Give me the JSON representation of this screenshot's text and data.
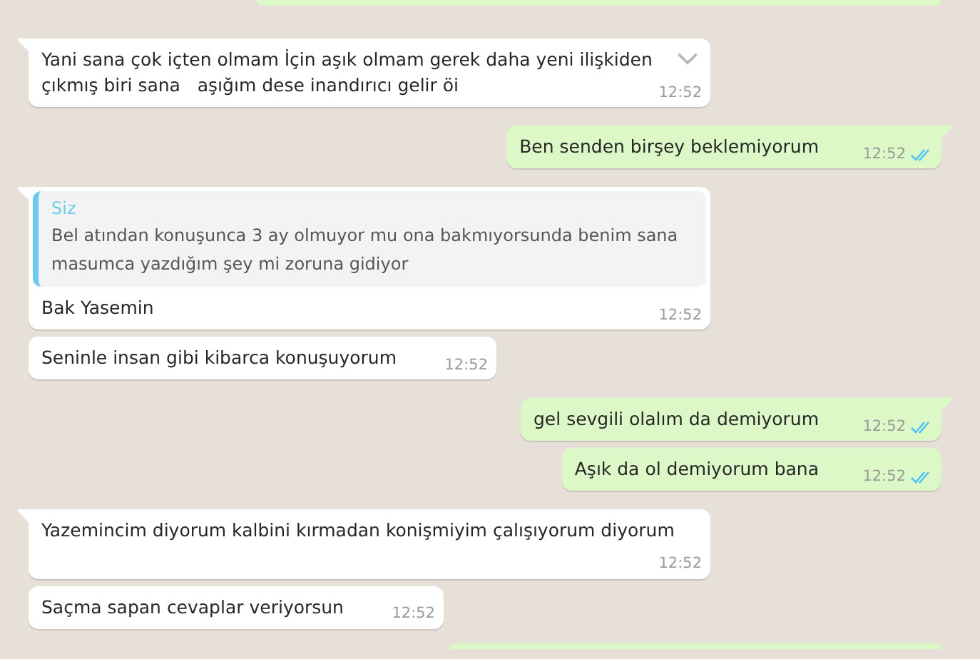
{
  "messages": [
    {
      "kind": "edge-out"
    },
    {
      "kind": "in",
      "tail": true,
      "menu": true,
      "text": "Yani sana çok içten olmam İçin aşık olmam gerek daha yeni ilişkiden çıkmış biri sana   aşığım dese inandırıcı gelir öi",
      "time": "12:52"
    },
    {
      "kind": "out",
      "tail": true,
      "read": true,
      "text": "Ben senden birşey beklemiyorum",
      "time": "12:52"
    },
    {
      "kind": "in",
      "tail": true,
      "quote": {
        "author": "Siz",
        "text": "Bel atından konuşunca 3 ay olmuyor mu ona bakmıyorsunda benim sana masumca yazdığım şey mi zoruna gidiyor"
      },
      "text": "Bak Yasemin",
      "time": "12:52"
    },
    {
      "kind": "in",
      "tail": false,
      "text": "Seninle insan gibi kibarca konuşuyorum",
      "time": "12:52"
    },
    {
      "kind": "out",
      "tail": true,
      "read": true,
      "text": "gel sevgili olalım da demiyorum",
      "time": "12:52"
    },
    {
      "kind": "out",
      "tail": false,
      "read": true,
      "text": "Aşık da ol demiyorum bana",
      "time": "12:52"
    },
    {
      "kind": "in",
      "tail": true,
      "text": "Yazemincim diyorum kalbini kırmadan konişmiyim çalışıyorum diyorum",
      "time": "12:52"
    },
    {
      "kind": "in",
      "tail": false,
      "text": "Saçma sapan cevaplar veriyorsun",
      "time": "12:52"
    },
    {
      "kind": "edge-out"
    }
  ]
}
